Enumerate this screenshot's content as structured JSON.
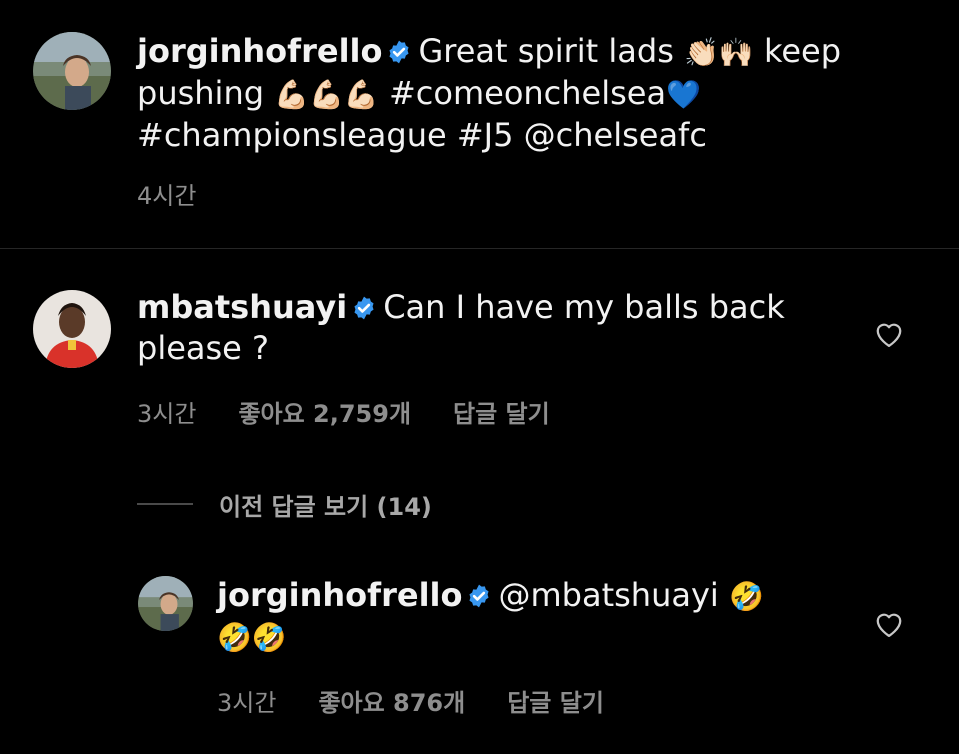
{
  "post": {
    "username": "jorginhofrello",
    "caption_line1_text": "Great spirit lads",
    "caption_emojis_1": "👏🏻🙌🏻",
    "caption_keep": "keep",
    "caption_pushing": "pushing",
    "caption_emojis_2": "💪🏻💪🏻💪🏻",
    "caption_hashtag_1": "#comeonchelsea",
    "caption_emoji_heart": "💙",
    "caption_line3": "#championsleague #J5 @chelseafc",
    "time": "4시간"
  },
  "comment": {
    "username": "mbatshuayi",
    "text_line1": "Can I have my balls back",
    "text_line2": "please ?",
    "time": "3시간",
    "likes": "좋아요 2,759개",
    "reply_label": "답글 달기"
  },
  "view_previous_replies": "이전 답글 보기 (14)",
  "reply": {
    "username": "jorginhofrello",
    "text": "@mbatshuayi",
    "emoji_1": "🤣",
    "emoji_2": "🤣🤣",
    "time": "3시간",
    "likes": "좋아요 876개",
    "reply_label": "답글 달기"
  },
  "colors": {
    "background": "#000000",
    "text": "#f2f2f2",
    "meta_text": "#8e8e8e",
    "verified_badge": "#3897f0",
    "divider": "#262626"
  },
  "icons": [
    "verified-badge-icon",
    "heart-icon"
  ]
}
